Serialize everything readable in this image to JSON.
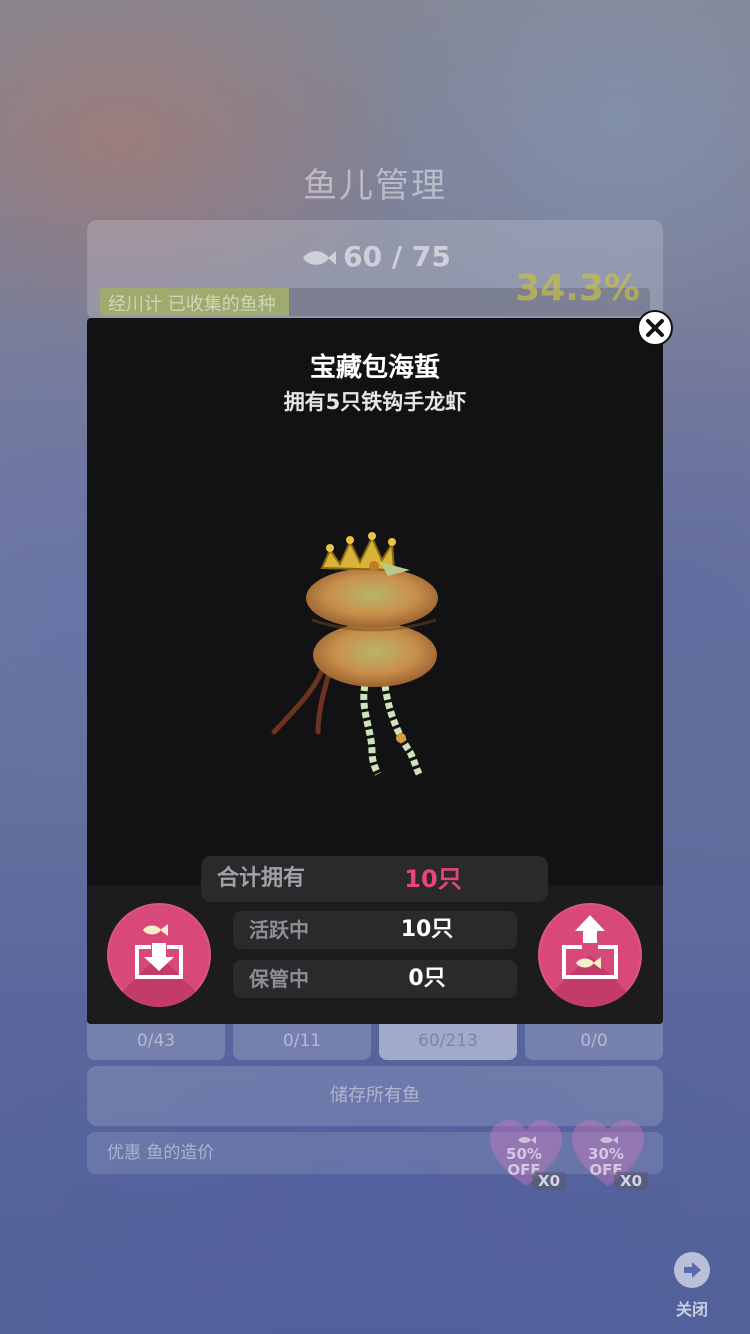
{
  "background_panel": {
    "title": "鱼儿管理",
    "fish_count": "60 / 75",
    "percent": "34.3%",
    "progress_fraction": 0.343,
    "progress_text": "经川计 已收集的鱼种",
    "tabs": [
      {
        "label": "0/43"
      },
      {
        "label": "0/11"
      },
      {
        "label": "60/213",
        "active": true
      },
      {
        "label": "0/0"
      }
    ],
    "store_all_label": "储存所有鱼",
    "discount_label": "优惠 鱼的造价",
    "discount_items": [
      {
        "percent": "50%",
        "off": "OFF",
        "multiplier": "X0"
      },
      {
        "percent": "30%",
        "off": "OFF",
        "multiplier": "X0"
      }
    ],
    "close_label": "关闭"
  },
  "modal": {
    "title": "宝藏包海蜇",
    "subtitle": "拥有5只铁钩手龙虾",
    "total": {
      "label": "合计拥有",
      "value": "10只"
    },
    "active": {
      "label": "活跃中",
      "value": "10只"
    },
    "stored": {
      "label": "保管中",
      "value": "0只"
    },
    "close_icon": "close-icon",
    "store_button_icon": "fish-store-down-icon",
    "release_button_icon": "fish-release-up-icon"
  },
  "colors": {
    "accent_pink": "#d9487a",
    "total_value": "#e8457a",
    "modal_bg": "#121214"
  }
}
